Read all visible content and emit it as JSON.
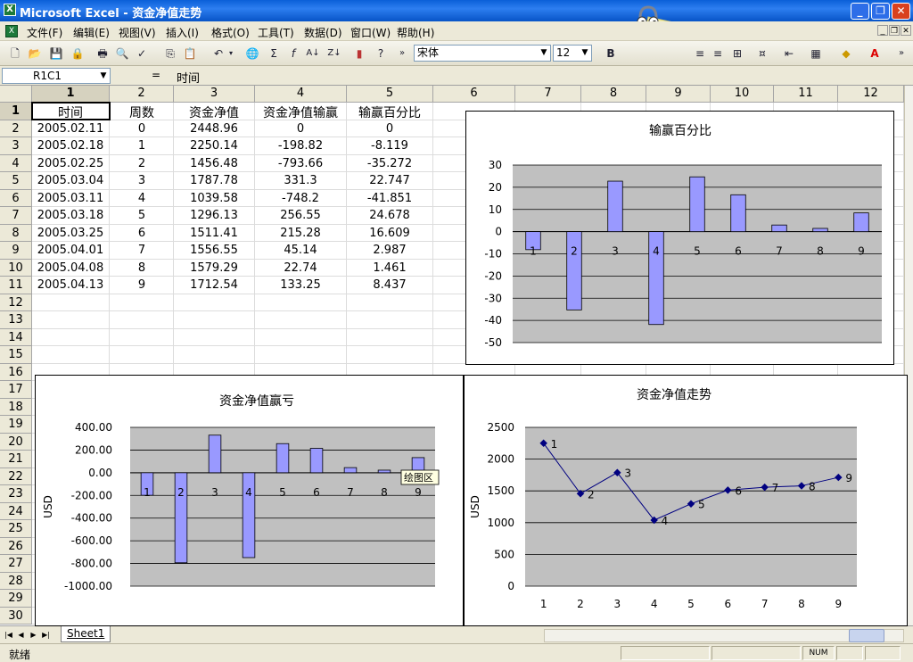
{
  "window": {
    "title": "Microsoft Excel - 资金净值走势"
  },
  "menu": [
    "文件(F)",
    "编辑(E)",
    "视图(V)",
    "插入(I)",
    "格式(O)",
    "工具(T)",
    "数据(D)",
    "窗口(W)",
    "帮助(H)"
  ],
  "toolbar": {
    "font_name": "宋体",
    "font_size": "12"
  },
  "formula_bar": {
    "name_box": "R1C1",
    "equals": "=",
    "content": "时间"
  },
  "columns": [
    "1",
    "2",
    "3",
    "4",
    "5",
    "6",
    "7",
    "8",
    "9",
    "10",
    "11",
    "12"
  ],
  "rows": [
    "1",
    "2",
    "3",
    "4",
    "5",
    "6",
    "7",
    "8",
    "9",
    "10",
    "11",
    "12",
    "13",
    "14",
    "15",
    "16",
    "17",
    "18",
    "19",
    "20",
    "21",
    "22",
    "23",
    "24",
    "25",
    "26",
    "27",
    "28",
    "29",
    "30"
  ],
  "table": {
    "headers": [
      "时间",
      "周数",
      "资金净值",
      "资金净值输赢",
      "输赢百分比"
    ],
    "data": [
      [
        "2005.02.11",
        "0",
        "2448.96",
        "0",
        "0"
      ],
      [
        "2005.02.18",
        "1",
        "2250.14",
        "-198.82",
        "-8.119"
      ],
      [
        "2005.02.25",
        "2",
        "1456.48",
        "-793.66",
        "-35.272"
      ],
      [
        "2005.03.04",
        "3",
        "1787.78",
        "331.3",
        "22.747"
      ],
      [
        "2005.03.11",
        "4",
        "1039.58",
        "-748.2",
        "-41.851"
      ],
      [
        "2005.03.18",
        "5",
        "1296.13",
        "256.55",
        "24.678"
      ],
      [
        "2005.03.25",
        "6",
        "1511.41",
        "215.28",
        "16.609"
      ],
      [
        "2005.04.01",
        "7",
        "1556.55",
        "45.14",
        "2.987"
      ],
      [
        "2005.04.08",
        "8",
        "1579.29",
        "22.74",
        "1.461"
      ],
      [
        "2005.04.13",
        "9",
        "1712.54",
        "133.25",
        "8.437"
      ]
    ]
  },
  "chart_data": [
    {
      "type": "bar",
      "title": "输赢百分比",
      "categories": [
        "1",
        "2",
        "3",
        "4",
        "5",
        "6",
        "7",
        "8",
        "9"
      ],
      "values": [
        -8.119,
        -35.272,
        22.747,
        -41.851,
        24.678,
        16.609,
        2.987,
        1.461,
        8.437
      ],
      "ylim": [
        -50,
        30
      ],
      "yticks": [
        "30",
        "20",
        "10",
        "0",
        "-10",
        "-20",
        "-30",
        "-40",
        "-50"
      ],
      "ylabel": "",
      "grid": true
    },
    {
      "type": "bar",
      "title": "资金净值赢亏",
      "categories": [
        "1",
        "2",
        "3",
        "4",
        "5",
        "6",
        "7",
        "8",
        "9"
      ],
      "values": [
        -198.82,
        -793.66,
        331.3,
        -748.2,
        256.55,
        215.28,
        45.14,
        22.74,
        133.25
      ],
      "ylim": [
        -1000,
        400
      ],
      "yticks": [
        "400.00",
        "200.00",
        "0.00",
        "-200.00",
        "-400.00",
        "-600.00",
        "-800.00",
        "-1000.00"
      ],
      "ylabel": "USD",
      "grid": true,
      "tooltip": "绘图区"
    },
    {
      "type": "line",
      "title": "资金净值走势",
      "x": [
        "1",
        "2",
        "3",
        "4",
        "5",
        "6",
        "7",
        "8",
        "9"
      ],
      "values": [
        2250.14,
        1456.48,
        1787.78,
        1039.58,
        1296.13,
        1511.41,
        1556.55,
        1579.29,
        1712.54
      ],
      "ylim": [
        0,
        2500
      ],
      "yticks": [
        "2500",
        "2000",
        "1500",
        "1000",
        "500",
        "0"
      ],
      "ylabel": "USD",
      "grid": true
    }
  ],
  "sheet_tabs": [
    "Sheet1"
  ],
  "status": {
    "text": "就绪",
    "num": "NUM"
  },
  "colors": {
    "bar_fill": "#9999ff",
    "line": "#000080",
    "plot_bg": "#c0c0c0",
    "title_bar": "#0a5fd8"
  }
}
